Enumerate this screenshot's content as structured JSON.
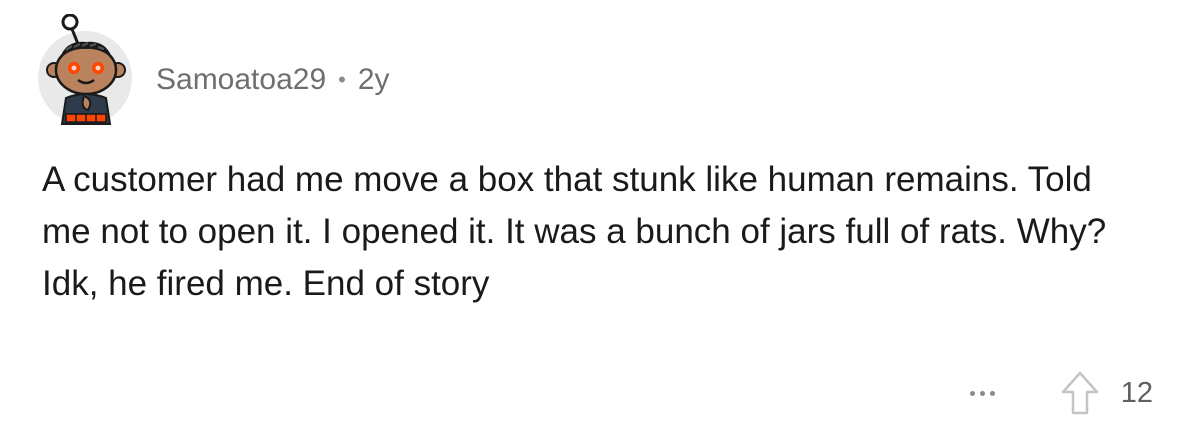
{
  "comment": {
    "author": "Samoatoa29",
    "separator": "•",
    "age": "2y",
    "text": "A customer had me move a box that stunk like human remains. Told me not to open it. I opened it. It was a bunch of jars full of rats. Why? Idk, he fired me. End of story",
    "score": "12"
  },
  "icons": {
    "avatar": "snoo-avatar-icon",
    "more": "more-options-icon",
    "upvote": "upvote-arrow-icon"
  },
  "colors": {
    "text": "#1a1a1b",
    "meta": "#6f6f6f",
    "icon": "#c4c4c4",
    "avatar_bg": "#e9e9ea",
    "avatar_accent": "#ff4500"
  }
}
